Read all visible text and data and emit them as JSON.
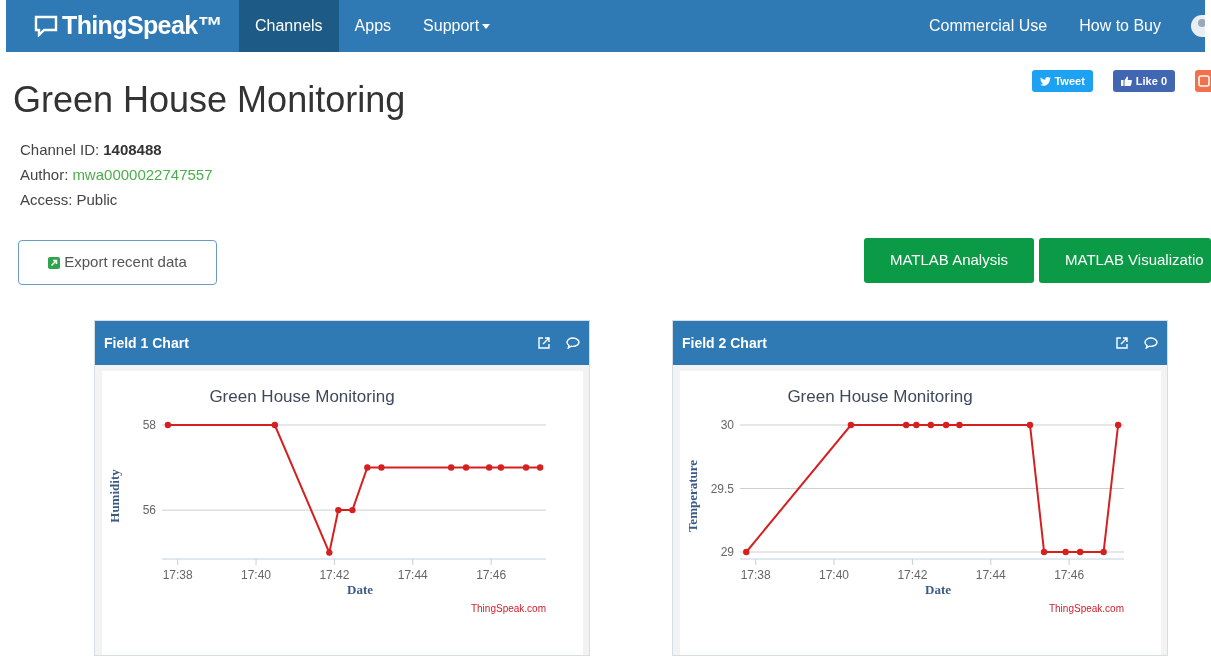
{
  "navbar": {
    "logo": "ThingSpeak™",
    "items": [
      {
        "label": "Channels",
        "selected": true,
        "kind": "link"
      },
      {
        "label": "Apps",
        "selected": false,
        "kind": "link"
      },
      {
        "label": "Support",
        "selected": false,
        "kind": "dropdown"
      }
    ],
    "right_items": [
      "Commercial Use",
      "How to Buy"
    ]
  },
  "page_title": "Green House Monitoring",
  "social_buttons": [
    {
      "kind": "tweet",
      "label": "Tweet"
    },
    {
      "kind": "like",
      "label": "Like 0"
    },
    {
      "kind": "share"
    }
  ],
  "channel_info": [
    {
      "label": "Channel ID:",
      "value": "1408488",
      "kind": "bold"
    },
    {
      "label": "Author:",
      "value": "mwa0000022747557",
      "kind": "link"
    },
    {
      "label": "Access:",
      "value": "Public",
      "kind": "plain"
    }
  ],
  "export_button": "Export recent data",
  "matlab_buttons": [
    "MATLAB Analysis",
    "MATLAB Visualizatio"
  ],
  "charts": [
    {
      "header": "Field 1 Chart",
      "credit": "ThingSpeak.com",
      "chart_data": {
        "type": "line",
        "title": "Green House Monitoring",
        "xlabel": "Date",
        "ylabel": "Humidity",
        "x": [
          1057.75,
          1060.48,
          1061.87,
          1062.1,
          1062.46,
          1062.84,
          1063.2,
          1064.98,
          1065.36,
          1065.95,
          1066.25,
          1066.89,
          1067.25
        ],
        "series": [
          {
            "color": "#d62020",
            "marker": "circle",
            "values": [
              58,
              58,
              55,
              56,
              56,
              57,
              57,
              57,
              57,
              57,
              57,
              57,
              57
            ]
          }
        ],
        "xlim": [
          1057.6,
          1067.4
        ],
        "ylim": [
          54.85,
          58
        ],
        "xticks": [
          {
            "value": 1058,
            "label": "17:38"
          },
          {
            "value": 1060,
            "label": "17:40"
          },
          {
            "value": 1062,
            "label": "17:42"
          },
          {
            "value": 1064,
            "label": "17:44"
          },
          {
            "value": 1066,
            "label": "17:46"
          }
        ],
        "yticks": [
          56,
          58
        ]
      }
    },
    {
      "header": "Field 2 Chart",
      "credit": "ThingSpeak.com",
      "chart_data": {
        "type": "line",
        "title": "Green House Monitoring",
        "xlabel": "Date",
        "ylabel": "Temperature",
        "x": [
          1057.76,
          1060.43,
          1061.84,
          1062.1,
          1062.47,
          1062.86,
          1063.2,
          1065.0,
          1065.36,
          1065.91,
          1066.28,
          1066.88,
          1067.25
        ],
        "series": [
          {
            "color": "#d62020",
            "marker": "circle",
            "values": [
              29,
              30,
              30,
              30,
              30,
              30,
              30,
              30,
              29,
              29,
              29,
              29,
              30
            ]
          }
        ],
        "xlim": [
          1057.6,
          1067.4
        ],
        "ylim": [
          28.945,
          30
        ],
        "xticks": [
          {
            "value": 1058,
            "label": "17:38"
          },
          {
            "value": 1060,
            "label": "17:40"
          },
          {
            "value": 1062,
            "label": "17:42"
          },
          {
            "value": 1064,
            "label": "17:44"
          },
          {
            "value": 1066,
            "label": "17:46"
          }
        ],
        "yticks": [
          29,
          {
            "value": 29.5,
            "label": "29.5"
          },
          30
        ]
      }
    }
  ]
}
